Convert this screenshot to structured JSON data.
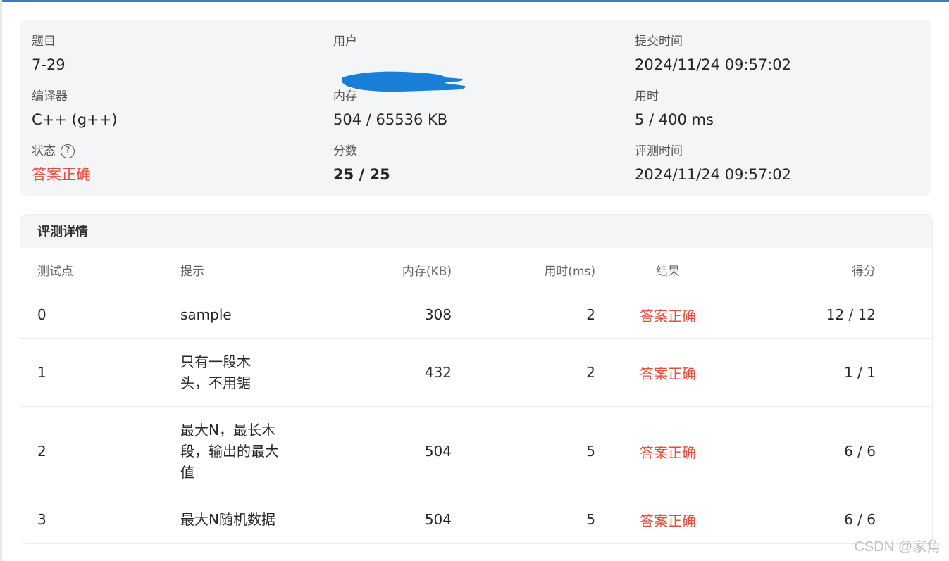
{
  "summary": {
    "problem_label": "题目",
    "problem_value": "7-29",
    "user_label": "用户",
    "submit_time_label": "提交时间",
    "submit_time_value": "2024/11/24 09:57:02",
    "compiler_label": "编译器",
    "compiler_value": "C++ (g++)",
    "memory_label": "内存",
    "memory_value": "504 / 65536 KB",
    "time_label": "用时",
    "time_value": "5 / 400 ms",
    "status_label": "状态",
    "status_value": "答案正确",
    "score_label": "分数",
    "score_value": "25 / 25",
    "judge_time_label": "评测时间",
    "judge_time_value": "2024/11/24 09:57:02"
  },
  "details": {
    "title": "评测详情",
    "columns": [
      "测试点",
      "提示",
      "内存(KB)",
      "用时(ms)",
      "结果",
      "得分"
    ],
    "rows": [
      {
        "id": "0",
        "hint": "sample",
        "memory": "308",
        "time": "2",
        "result": "答案正确",
        "score": "12 / 12"
      },
      {
        "id": "1",
        "hint": "只有一段木头，不用锯",
        "memory": "432",
        "time": "2",
        "result": "答案正确",
        "score": "1 / 1"
      },
      {
        "id": "2",
        "hint": "最大N，最长木段，输出的最大值",
        "memory": "504",
        "time": "5",
        "result": "答案正确",
        "score": "6 / 6"
      },
      {
        "id": "3",
        "hint": "最大N随机数据",
        "memory": "504",
        "time": "5",
        "result": "答案正确",
        "score": "6 / 6"
      }
    ]
  },
  "colors": {
    "accepted": "#e74c3c",
    "card_bg": "#f4f5f7",
    "redaction": "#1a7fd6"
  },
  "watermark": "CSDN @家角"
}
